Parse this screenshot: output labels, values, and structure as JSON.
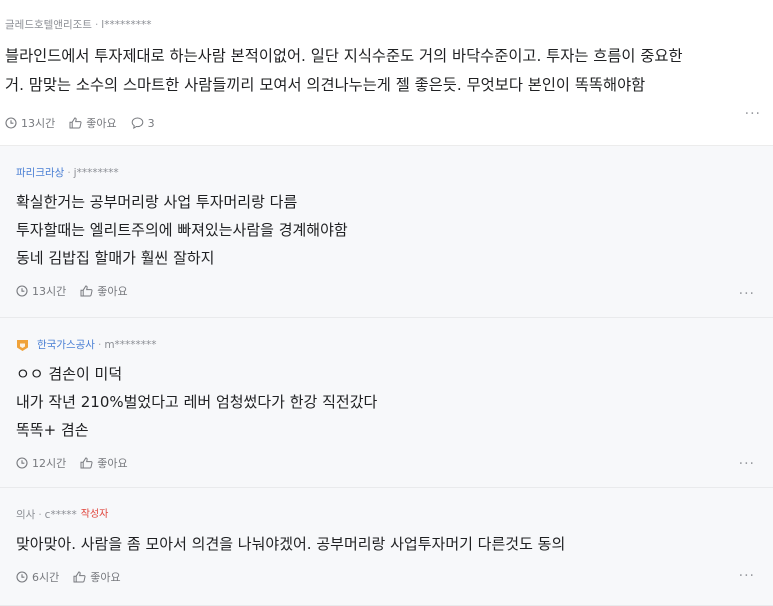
{
  "comments": [
    {
      "company": "글레드호텔앤리조트",
      "user": "l*********",
      "lines": [
        "블라인드에서 투자제대로 하는사람 본적이없어. 일단 지식수준도 거의 바닥수준이고. 투자는 흐름이 중요한",
        "거. 맘맞는 소수의 스마트한 사람들끼리 모여서 의견나누는게 젤 좋은듯. 무엇보다 본인이 똑똑해야함"
      ],
      "time": "13시간",
      "like_label": "좋아요",
      "reply_count": "3",
      "more": "···"
    },
    {
      "company": "파리크라상",
      "user": "j********",
      "lines": [
        "확실한거는 공부머리랑 사업 투자머리랑 다름",
        "투자할때는 엘리트주의에 빠져있는사람을 경계해야함",
        "동네 김밥집 할매가 훨씬 잘하지"
      ],
      "time": "13시간",
      "like_label": "좋아요",
      "more": "···"
    },
    {
      "company": "한국가스공사",
      "user": "m********",
      "lines": [
        "ㅇㅇ 겸손이 미덕",
        "내가 작년 210%벌었다고 레버 엄청썼다가 한강 직전갔다",
        "똑똑+ 겸손"
      ],
      "time": "12시간",
      "like_label": "좋아요",
      "more": "···"
    },
    {
      "company": "의사",
      "user": "c*****",
      "author_tag": "작성자",
      "lines": [
        "맞아맞아. 사람을 좀 모아서 의견을 나눠야겠어. 공부머리랑 사업투자머기 다른것도 동의"
      ],
      "time": "6시간",
      "like_label": "좋아요",
      "more": "···"
    }
  ],
  "colors": {
    "accent_company": "#4a7fd4",
    "author_tag": "#e0453c",
    "reply_bg": "#f7f8fa",
    "badge": "#f0a23a"
  },
  "icons": [
    "clock-icon",
    "thumbs-up-icon",
    "speech-bubble-icon",
    "more-icon",
    "company-badge-icon"
  ]
}
